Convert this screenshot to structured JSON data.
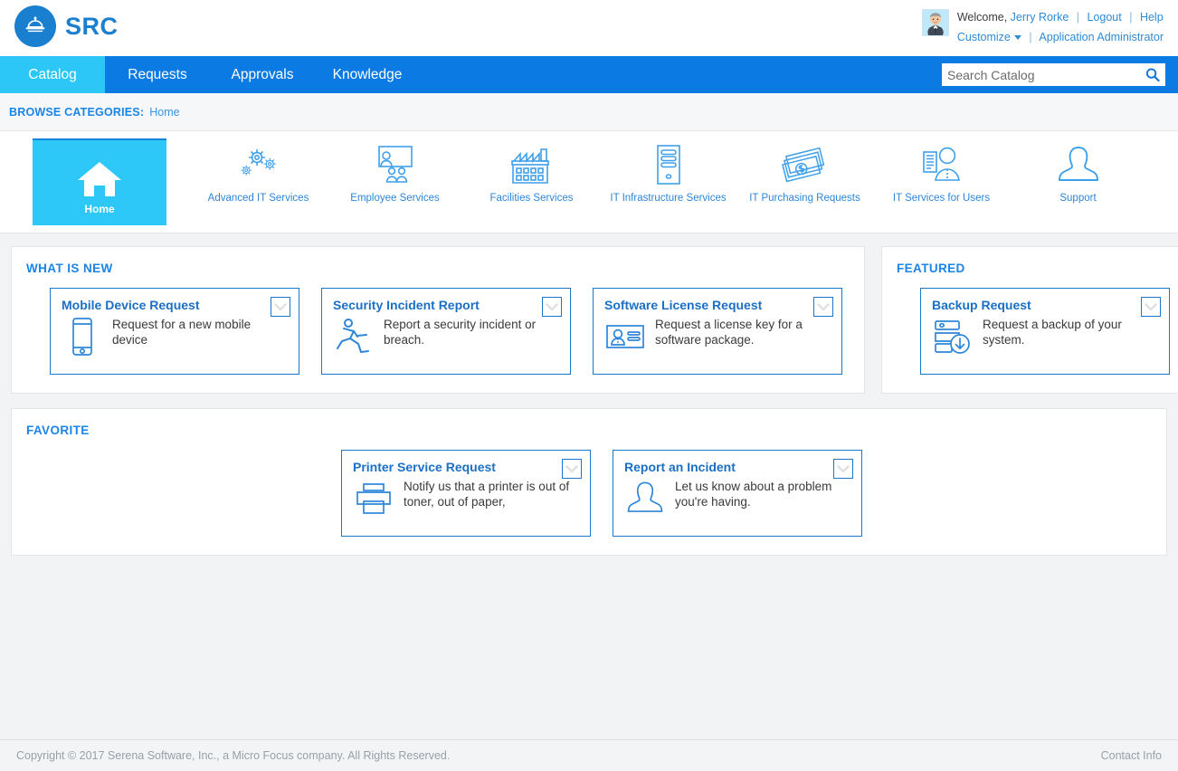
{
  "header": {
    "logo_text": "SRC",
    "logo_icon": "service-bell-icon",
    "welcome_label": "Welcome,",
    "user_name": "Jerry Rorke",
    "logout_label": "Logout",
    "help_label": "Help",
    "customize_label": "Customize",
    "role_label": "Application Administrator",
    "separator": "|"
  },
  "nav": {
    "tabs": [
      {
        "label": "Catalog",
        "active": true
      },
      {
        "label": "Requests",
        "active": false
      },
      {
        "label": "Approvals",
        "active": false
      },
      {
        "label": "Knowledge",
        "active": false
      }
    ],
    "search": {
      "placeholder": "Search Catalog",
      "value": "",
      "icon": "search-icon"
    }
  },
  "breadcrumb": {
    "label": "BROWSE CATEGORIES:",
    "current": "Home"
  },
  "categories": [
    {
      "label": "Home",
      "icon": "home-icon",
      "active": true
    },
    {
      "label": "Advanced IT Services",
      "icon": "gears-icon",
      "active": false
    },
    {
      "label": "Employee Services",
      "icon": "presentation-people-icon",
      "active": false
    },
    {
      "label": "Facilities Services",
      "icon": "factory-icon",
      "active": false
    },
    {
      "label": "IT Infrastructure Services",
      "icon": "server-tower-icon",
      "active": false
    },
    {
      "label": "IT Purchasing Requests",
      "icon": "banknotes-icon",
      "active": false
    },
    {
      "label": "IT Services for Users",
      "icon": "user-document-icon",
      "active": false
    },
    {
      "label": "Support",
      "icon": "person-silhouette-icon",
      "active": false
    }
  ],
  "panels": {
    "whats_new": {
      "title": "WHAT IS NEW",
      "cards": [
        {
          "title": "Mobile Device Request",
          "desc": "Request for a new mobile device",
          "icon": "smartphone-icon"
        },
        {
          "title": "Security Incident Report",
          "desc": "Report a security incident or breach.",
          "icon": "running-person-icon"
        },
        {
          "title": "Software License Request",
          "desc": "Request a license key for a software package.",
          "icon": "id-badge-icon"
        }
      ]
    },
    "featured": {
      "title": "FEATURED",
      "cards": [
        {
          "title": "Backup Request",
          "desc": "Request a backup of your system.",
          "icon": "server-download-icon"
        }
      ]
    },
    "favorite": {
      "title": "FAVORITE",
      "cards": [
        {
          "title": "Printer Service Request",
          "desc": "Notify us that a printer is out of toner, out of paper,",
          "icon": "printer-icon"
        },
        {
          "title": "Report an Incident",
          "desc": "Let us know about a problem you're having.",
          "icon": "person-silhouette-icon"
        }
      ]
    }
  },
  "footer": {
    "copyright": "Copyright © 2017 Serena Software, Inc., a Micro Focus company. All Rights Reserved.",
    "contact": "Contact Info"
  },
  "colors": {
    "brand_blue": "#1B7FD0",
    "nav_blue": "#0B7AE3",
    "active_cyan": "#2DC8F8",
    "link_blue": "#2D8BD6",
    "card_border": "#1B77C9"
  }
}
